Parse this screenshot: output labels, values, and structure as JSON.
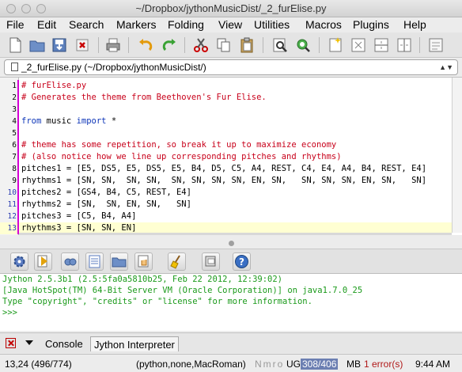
{
  "window": {
    "title": "~/Dropbox/jythonMusicDist/_2_furElise.py"
  },
  "menu": [
    "File",
    "Edit",
    "Search",
    "Markers",
    "Folding",
    "View",
    "Utilities",
    "Macros",
    "Plugins",
    "Help"
  ],
  "buffer": {
    "label": "_2_furElise.py (~/Dropbox/jythonMusicDist/)"
  },
  "code_lines": [
    {
      "n": "1",
      "text": "# furElise.py",
      "kind": "comment"
    },
    {
      "n": "2",
      "text": "# Generates the theme from Beethoven's Fur Elise.",
      "kind": "comment"
    },
    {
      "n": "3",
      "text": "",
      "kind": "plain"
    },
    {
      "n": "4",
      "kw1": "from",
      "mid": " music ",
      "kw2": "import",
      "rest": " *",
      "kind": "import"
    },
    {
      "n": "5",
      "text": "",
      "kind": "plain"
    },
    {
      "n": "6",
      "text": "# theme has some repetition, so break it up to maximize economy",
      "kind": "comment"
    },
    {
      "n": "7",
      "text": "# (also notice how we line up corresponding pitches and rhythms)",
      "kind": "comment"
    },
    {
      "n": "8",
      "text": "pitches1 = [E5, DS5, E5, DS5, E5, B4, D5, C5, A4, REST, C4, E4, A4, B4, REST, E4]",
      "kind": "plain"
    },
    {
      "n": "9",
      "text": "rhythms1 = [SN, SN,  SN, SN,  SN, SN, SN, SN, EN, SN,   SN, SN, SN, EN, SN,   SN]",
      "kind": "plain"
    },
    {
      "n": "10",
      "text": "pitches2 = [GS4, B4, C5, REST, E4]",
      "kind": "plain"
    },
    {
      "n": "11",
      "text": "rhythms2 = [SN,  SN, EN, SN,   SN]",
      "kind": "plain"
    },
    {
      "n": "12",
      "text": "pitches3 = [C5, B4, A4]",
      "kind": "plain"
    },
    {
      "n": "13",
      "text": "rhythms3 = [SN, SN, EN]",
      "kind": "plain"
    }
  ],
  "console": {
    "lines": [
      "Jython 2.5.3b1 (2.5:5fa0a5810b25, Feb 22 2012, 12:39:02)",
      "[Java HotSpot(TM) 64-Bit Server VM (Oracle Corporation)] on java1.7.0_25",
      "Type \"copyright\", \"credits\" or \"license\" for more information.",
      ">>>"
    ]
  },
  "tabs": {
    "console": "Console",
    "jython": "Jython Interpreter"
  },
  "status": {
    "position": "13,24 (496/774)",
    "mode": "(python,none,MacRoman)",
    "flags": "Nmro",
    "ug": "UG",
    "memory": "308/406",
    "mb": "MB",
    "errors": "1 error(s)",
    "time": "9:44 AM"
  },
  "colors": {
    "comment": "#c8001a",
    "keyword": "#0d35b8",
    "console_text": "#1a9a1a",
    "current_line": "#ffffd2"
  }
}
